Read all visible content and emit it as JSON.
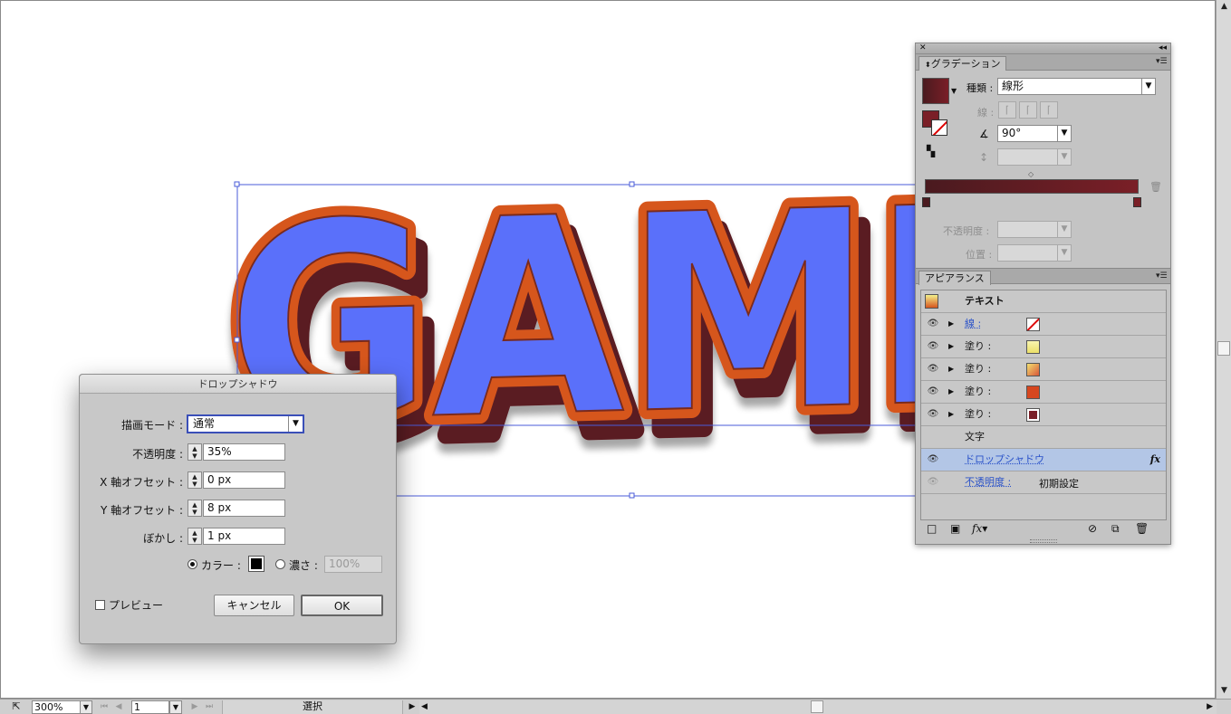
{
  "artwork": {
    "text": "GAME"
  },
  "statusbar": {
    "zoom": "300%",
    "page": "1",
    "status": "選択"
  },
  "gradient_panel": {
    "tab": "グラデーション",
    "type_label": "種類 :",
    "type_value": "線形",
    "stroke_label": "線 :",
    "angle_value": "90°",
    "aspect_value": "",
    "opacity_label": "不透明度 :",
    "opacity_value": "",
    "location_label": "位置 :",
    "location_value": "",
    "colors": {
      "start": "#4a1a1f",
      "end": "#7a1f27"
    }
  },
  "appearance_panel": {
    "tab": "アピアランス",
    "header": "テキスト",
    "rows": [
      {
        "label": "線 :",
        "swatch": "stroke-none"
      },
      {
        "label": "塗り :",
        "swatch": "#f3ef8a"
      },
      {
        "label": "塗り :",
        "swatch": "#e8a04a"
      },
      {
        "label": "塗り :",
        "swatch": "#d6471f"
      },
      {
        "label": "塗り :",
        "swatch": "#7a1f27"
      }
    ],
    "characters": "文字",
    "effect": "ドロップシャドウ",
    "effect_fx": "fx",
    "opacity_label": "不透明度 :",
    "opacity_value": "初期設定"
  },
  "dialog": {
    "title": "ドロップシャドウ",
    "mode_label": "描画モード :",
    "mode_value": "通常",
    "opacity_label": "不透明度 :",
    "opacity_value": "35%",
    "x_label": "X 軸オフセット :",
    "x_value": "0 px",
    "y_label": "Y 軸オフセット :",
    "y_value": "8 px",
    "blur_label": "ぼかし :",
    "blur_value": "1 px",
    "color_label": "カラー :",
    "darkness_label": "濃さ :",
    "darkness_value": "100%",
    "preview_label": "プレビュー",
    "cancel_label": "キャンセル",
    "ok_label": "OK"
  }
}
